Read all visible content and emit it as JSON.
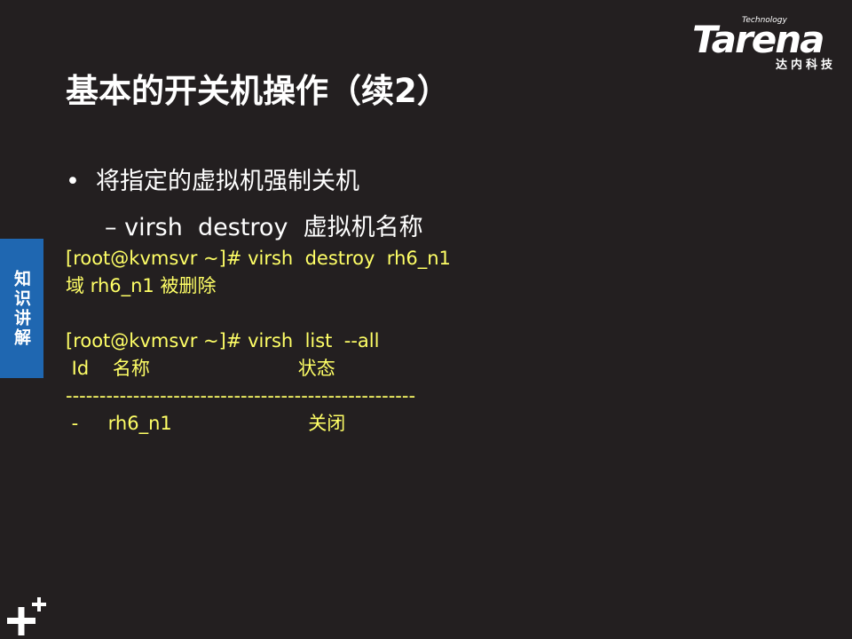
{
  "brand": {
    "technology": "Technology",
    "wordmark": "Tarena",
    "chinese": "达内科技"
  },
  "title": "基本的开关机操作（续2）",
  "bullet": {
    "symbol": "•",
    "text": "将指定的虚拟机强制关机"
  },
  "sub_bullet": {
    "dash": "–",
    "text": "virsh  destroy  虚拟机名称"
  },
  "code_lines": [
    "[root@kvmsvr ~]# virsh  destroy  rh6_n1",
    "域 rh6_n1 被删除",
    "",
    "[root@kvmsvr ~]# virsh  list  --all",
    " Id    名称                         状态",
    "----------------------------------------------------",
    " -     rh6_n1                       关闭"
  ],
  "side_tab": {
    "label": "知识讲解"
  },
  "colors": {
    "background": "#231f20",
    "code_text": "#ffff66",
    "tab_blue": "#1f67b1",
    "text": "#ffffff"
  },
  "icons": {
    "plus_logo": "plus-plus-icon"
  }
}
